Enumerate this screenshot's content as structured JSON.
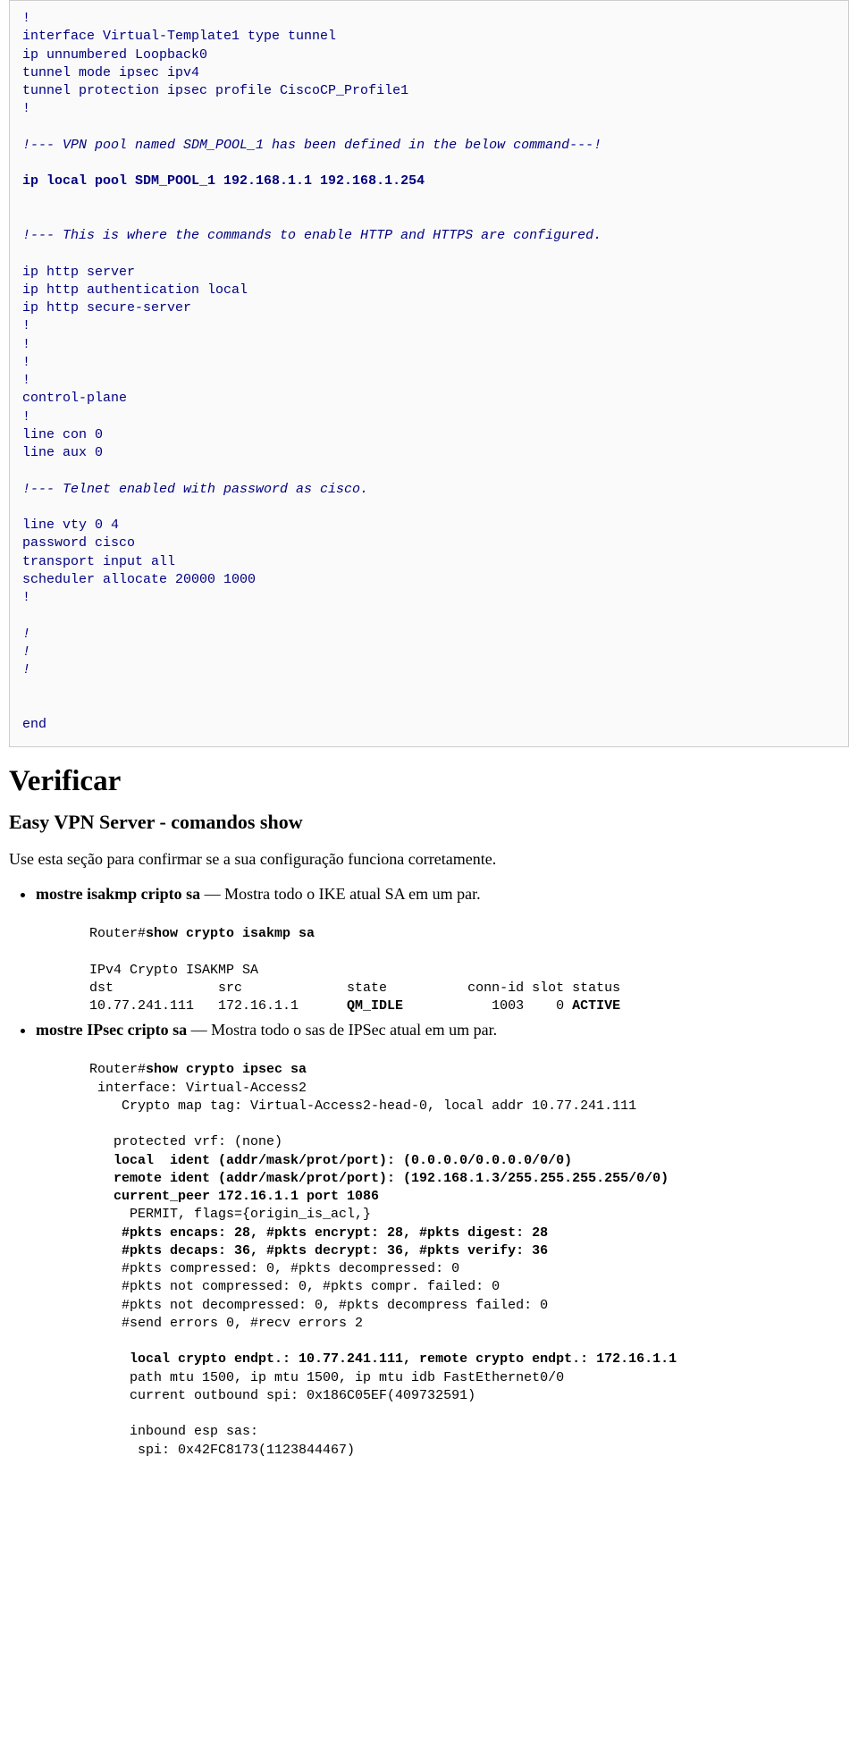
{
  "config": {
    "l1": "!",
    "l2": "interface Virtual-Template1 type tunnel",
    "l3": "ip unnumbered Loopback0",
    "l4": "tunnel mode ipsec ipv4",
    "l5": "tunnel protection ipsec profile CiscoCP_Profile1",
    "l6": "!",
    "l7": "!--- VPN pool named SDM_POOL_1 has been defined in the below command---!",
    "l8": "ip local pool SDM_POOL_1 192.168.1.1 192.168.1.254",
    "l9": "!--- This is where the commands to enable HTTP and HTTPS are configured.",
    "l10": "ip http server",
    "l11": "ip http authentication local",
    "l12": "ip http secure-server",
    "l13": "!",
    "l14": "!",
    "l15": "!",
    "l16": "!",
    "l17": "control-plane",
    "l18": "!",
    "l19": "line con 0",
    "l20": "line aux 0",
    "l21": "!--- Telnet enabled with password as cisco.",
    "l22": "line vty 0 4",
    "l23": "password cisco",
    "l24": "transport input all",
    "l25": "scheduler allocate 20000 1000",
    "l26": "!",
    "l27": "!",
    "l28": "!",
    "l29": "!",
    "l30": "end"
  },
  "h2": "Verificar",
  "h3": "Easy VPN Server - comandos show",
  "para1": "Use esta seção para confirmar se a sua configuração funciona corretamente.",
  "bullet1_bold": "mostre isakmp cripto sa",
  "bullet1_rest": " — Mostra todo o IKE atual SA em um par.",
  "isakmp": {
    "prompt": "Router#",
    "cmd": "show crypto isakmp sa",
    "l1": "IPv4 Crypto ISAKMP SA",
    "l2": "dst             src             state          conn-id slot status",
    "l3a": "10.77.241.111   172.16.1.1      ",
    "l3b": "QM_IDLE",
    "l3c": "           1003    0 ",
    "l3d": "ACTIVE"
  },
  "bullet2_bold": "mostre IPsec cripto sa",
  "bullet2_rest": " — Mostra todo o sas de IPSec atual em um par.",
  "ipsec": {
    "prompt": "Router#",
    "cmd": "show crypto ipsec sa",
    "l1": " interface: Virtual-Access2",
    "l2": "    Crypto map tag: Virtual-Access2-head-0, local addr 10.77.241.111",
    "l3": "   protected vrf: (none)",
    "l4": "   local  ident (addr/mask/prot/port): (0.0.0.0/0.0.0.0/0/0)",
    "l5": "   remote ident (addr/mask/prot/port): (192.168.1.3/255.255.255.255/0/0)",
    "l6": "   current_peer 172.16.1.1 port 1086",
    "l7": "     PERMIT, flags={origin_is_acl,}",
    "l8": "    #pkts encaps: 28, #pkts encrypt: 28, #pkts digest: 28",
    "l9": "    #pkts decaps: 36, #pkts decrypt: 36, #pkts verify: 36",
    "l10": "    #pkts compressed: 0, #pkts decompressed: 0",
    "l11": "    #pkts not compressed: 0, #pkts compr. failed: 0",
    "l12": "    #pkts not decompressed: 0, #pkts decompress failed: 0",
    "l13": "    #send errors 0, #recv errors 2",
    "l14": "     local crypto endpt.: 10.77.241.111, remote crypto endpt.: 172.16.1.1",
    "l15": "     path mtu 1500, ip mtu 1500, ip mtu idb FastEthernet0/0",
    "l16": "     current outbound spi: 0x186C05EF(409732591)",
    "l17": "     inbound esp sas:",
    "l18": "      spi: 0x42FC8173(1123844467)"
  }
}
